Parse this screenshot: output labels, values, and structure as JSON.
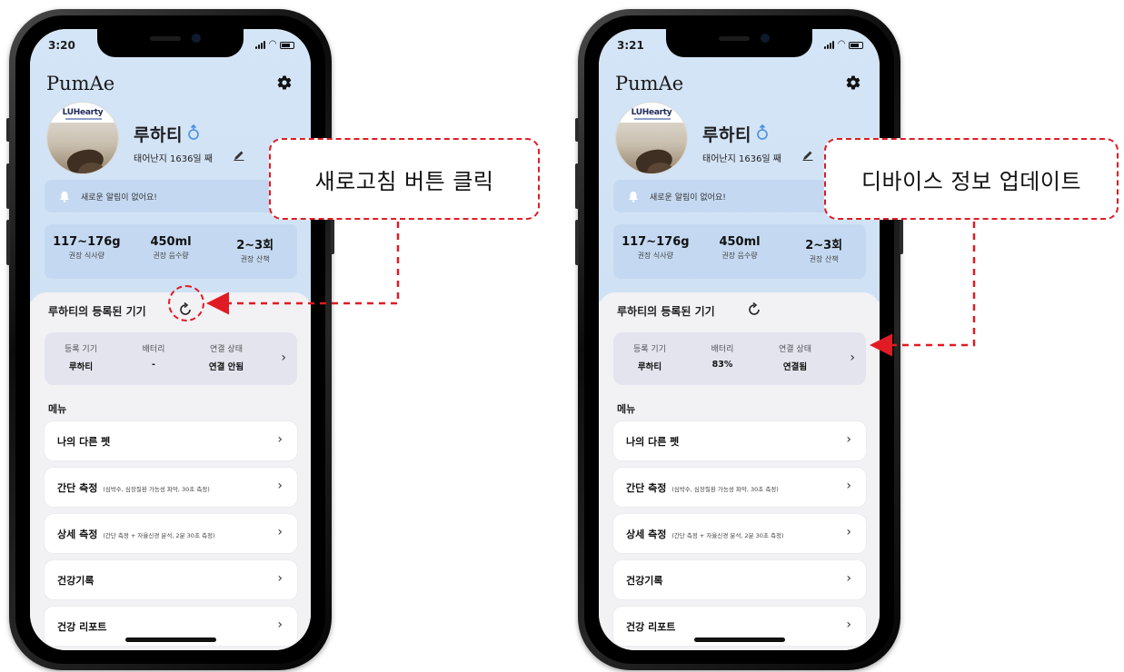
{
  "left_phone": {
    "status": {
      "time": "3:20"
    },
    "brand": "PumAe",
    "avatar_logo": "LUHearty",
    "pet": {
      "name": "루하티",
      "days": "태어난지 1636일 째"
    },
    "alert": "새로운 알림이 없어요!",
    "stats": [
      {
        "value": "117~176g",
        "label": "권장 식사량"
      },
      {
        "value": "450ml",
        "label": "권장 음수량"
      },
      {
        "value": "2~3회",
        "label": "권장 산책"
      }
    ],
    "devices_title": "루하티의 등록된 기기",
    "device": {
      "col1_label": "등록 기기",
      "col1_value": "루하티",
      "col2_label": "배터리",
      "col2_value": "-",
      "col3_label": "연결 상태",
      "col3_value": "연결 안됨"
    },
    "menu_title": "메뉴",
    "menu": [
      {
        "label": "나의 다른 펫",
        "sub": ""
      },
      {
        "label": "간단 측정",
        "sub": "(심박수, 심장질환 가능성 파악, 30초 측정)"
      },
      {
        "label": "상세 측정",
        "sub": "(간단 측정 + 자율신경 분석, 2분 30초 측정)"
      },
      {
        "label": "건강기록",
        "sub": ""
      },
      {
        "label": "건강 리포트",
        "sub": ""
      }
    ]
  },
  "right_phone": {
    "status": {
      "time": "3:21"
    },
    "brand": "PumAe",
    "avatar_logo": "LUHearty",
    "pet": {
      "name": "루하티",
      "days": "태어난지 1636일 째"
    },
    "alert": "새로운 알림이 없어요!",
    "stats": [
      {
        "value": "117~176g",
        "label": "권장 식사량"
      },
      {
        "value": "450ml",
        "label": "권장 음수량"
      },
      {
        "value": "2~3회",
        "label": "권장 산책"
      }
    ],
    "devices_title": "루하티의 등록된 기기",
    "device": {
      "col1_label": "등록 기기",
      "col1_value": "루하티",
      "col2_label": "배터리",
      "col2_value": "83%",
      "col3_label": "연결 상태",
      "col3_value": "연결됨"
    },
    "menu_title": "메뉴",
    "menu": [
      {
        "label": "나의 다른 펫",
        "sub": ""
      },
      {
        "label": "간단 측정",
        "sub": "(심박수, 심장질환 가능성 파악, 30초 측정)"
      },
      {
        "label": "상세 측정",
        "sub": "(간단 측정 + 자율신경 분석, 2분 30초 측정)"
      },
      {
        "label": "건강기록",
        "sub": ""
      },
      {
        "label": "건강 리포트",
        "sub": ""
      }
    ]
  },
  "annotations": {
    "left_callout": "새로고침 버튼 클릭",
    "right_callout": "디바이스 정보 업데이트"
  },
  "colors": {
    "accent_red": "#e01b24",
    "header_blue": "#d4e5f7",
    "card_blue": "#c4d9f1"
  }
}
